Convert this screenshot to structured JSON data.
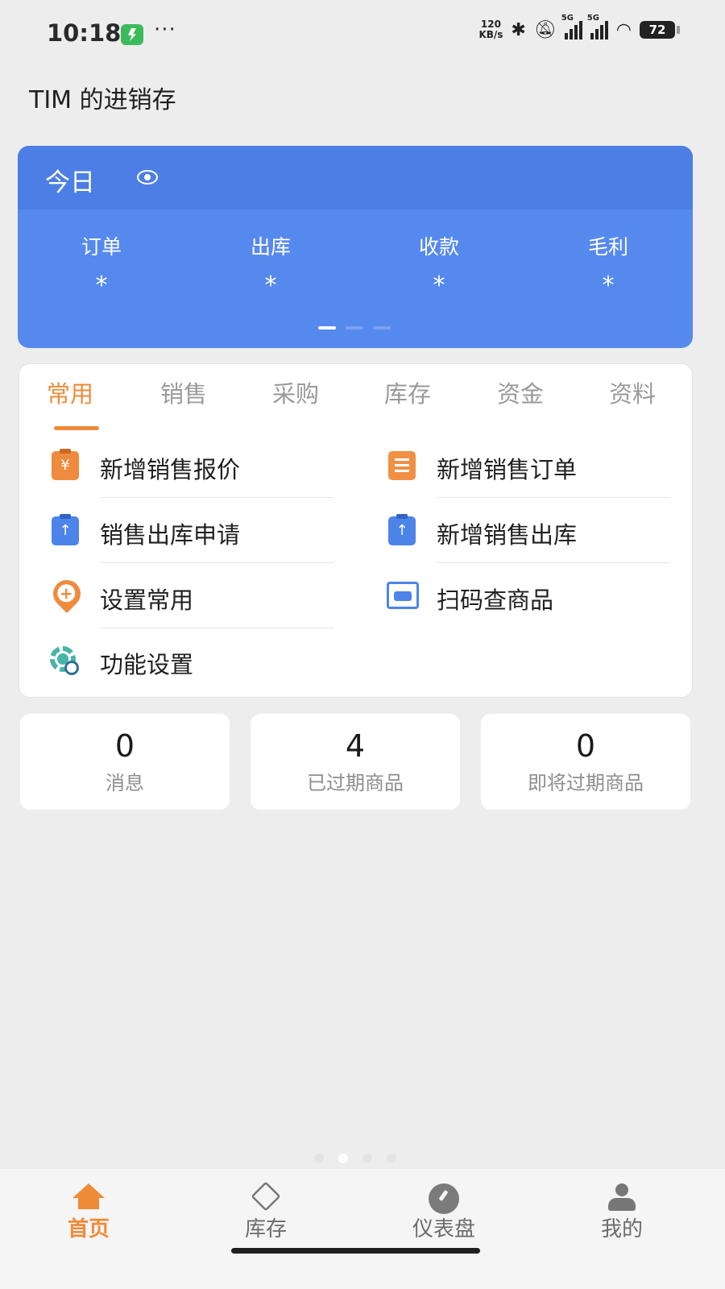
{
  "status_bar": {
    "time": "10:18",
    "more": "···",
    "net_speed_value": "120",
    "net_speed_unit": "KB/s",
    "signal_tag_1": "5G",
    "signal_tag_2": "5G",
    "battery": "72",
    "icons": [
      "shield-app-icon",
      "bluetooth-icon",
      "mute-bell-icon",
      "signal-icon",
      "signal-icon",
      "wifi-icon",
      "battery-icon"
    ]
  },
  "app_title": "TIM 的进销存",
  "today": {
    "title": "今日",
    "stats": [
      {
        "label": "订单",
        "value": "*"
      },
      {
        "label": "出库",
        "value": "*"
      },
      {
        "label": "收款",
        "value": "*"
      },
      {
        "label": "毛利",
        "value": "*"
      }
    ],
    "pager_pages": 3,
    "pager_active": 1
  },
  "tabs": [
    {
      "label": "常用",
      "active": true
    },
    {
      "label": "销售",
      "active": false
    },
    {
      "label": "采购",
      "active": false
    },
    {
      "label": "库存",
      "active": false
    },
    {
      "label": "资金",
      "active": false
    },
    {
      "label": "资料",
      "active": false
    }
  ],
  "shortcuts": [
    {
      "label": "新增销售报价",
      "icon": "quote-doc-icon"
    },
    {
      "label": "新增销售订单",
      "icon": "order-list-icon"
    },
    {
      "label": "销售出库申请",
      "icon": "outbound-request-icon"
    },
    {
      "label": "新增销售出库",
      "icon": "outbound-doc-icon"
    },
    {
      "label": "设置常用",
      "icon": "add-pin-icon"
    },
    {
      "label": "扫码查商品",
      "icon": "scan-icon"
    },
    {
      "label": "功能设置",
      "icon": "gear-icon"
    }
  ],
  "counters": [
    {
      "value": "0",
      "label": "消息"
    },
    {
      "value": "4",
      "label": "已过期商品"
    },
    {
      "value": "0",
      "label": "即将过期商品"
    }
  ],
  "page_indicator": {
    "pages": 4,
    "active": 2
  },
  "bottom_nav": [
    {
      "label": "首页",
      "icon": "home-icon",
      "active": true
    },
    {
      "label": "库存",
      "icon": "box-icon",
      "active": false
    },
    {
      "label": "仪表盘",
      "icon": "gauge-icon",
      "active": false
    },
    {
      "label": "我的",
      "icon": "person-icon",
      "active": false
    }
  ],
  "colors": {
    "accent": "#ee8b38",
    "primary_blue": "#5589ee",
    "header_blue": "#4c7ee5",
    "background": "#ededed"
  }
}
